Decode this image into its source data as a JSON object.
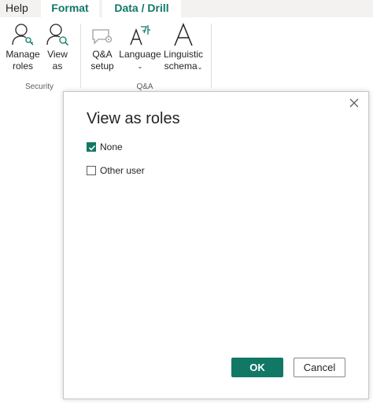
{
  "ribbon": {
    "tabs": [
      {
        "label": "Help"
      },
      {
        "label": "Format"
      },
      {
        "label": "Data / Drill"
      }
    ],
    "groups": {
      "security": {
        "label": "Security",
        "manage_roles": {
          "line1": "Manage",
          "line2": "roles",
          "icon": "person-key-icon"
        },
        "view_as": {
          "line1": "View",
          "line2": "as",
          "icon": "person-search-icon"
        }
      },
      "qa": {
        "label": "Q&A",
        "qa_setup": {
          "line1": "Q&A",
          "line2": "setup",
          "icon": "chat-gear-icon"
        },
        "language": {
          "line1": "Language",
          "line2": "⌄",
          "icon": "language-icon"
        },
        "linguistic_schema": {
          "line1": "Linguistic",
          "line2": "schema",
          "chevron": "⌄",
          "icon": "linguistic-schema-icon"
        }
      }
    }
  },
  "dialog": {
    "title": "View as roles",
    "options": [
      {
        "label": "None",
        "checked": true
      },
      {
        "label": "Other user",
        "checked": false
      }
    ],
    "ok_label": "OK",
    "cancel_label": "Cancel"
  },
  "colors": {
    "accent": "#117865",
    "text": "#252423",
    "border": "#c8c6c4"
  }
}
